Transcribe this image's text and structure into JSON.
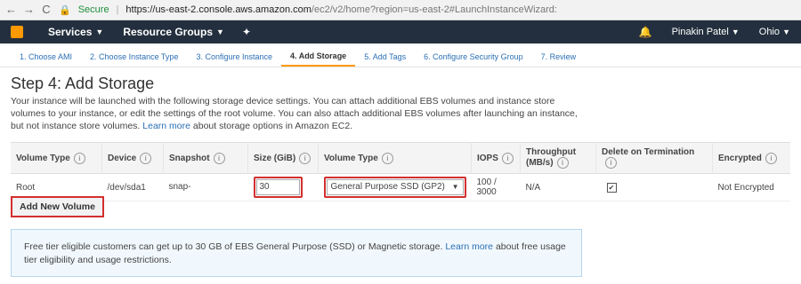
{
  "browser": {
    "secure_label": "Secure",
    "url_host": "https://us-east-2.console.aws.amazon.com",
    "url_path": "/ec2/v2/home?region=us-east-2#LaunchInstanceWizard:"
  },
  "topnav": {
    "services": "Services",
    "resource_groups": "Resource Groups",
    "user": "Pinakin Patel",
    "region": "Ohio"
  },
  "tabs": [
    {
      "label": "1. Choose AMI"
    },
    {
      "label": "2. Choose Instance Type"
    },
    {
      "label": "3. Configure Instance"
    },
    {
      "label": "4. Add Storage"
    },
    {
      "label": "5. Add Tags"
    },
    {
      "label": "6. Configure Security Group"
    },
    {
      "label": "7. Review"
    }
  ],
  "page": {
    "title": "Step 4: Add Storage",
    "description": "Your instance will be launched with the following storage device settings. You can attach additional EBS volumes and instance store volumes to your instance, or edit the settings of the root volume. You can also attach additional EBS volumes after launching an instance, but not instance store volumes.",
    "learn_more": "Learn more",
    "description_tail": "about storage options in Amazon EC2."
  },
  "table": {
    "headers": [
      "Volume Type",
      "Device",
      "Snapshot",
      "Size (GiB)",
      "Volume Type",
      "IOPS",
      "Throughput (MB/s)",
      "Delete on Termination",
      "Encrypted"
    ],
    "row": {
      "volume_type": "Root",
      "device": "/dev/sda1",
      "snapshot": "snap-",
      "size": "30",
      "ebs_type": "General Purpose SSD (GP2)",
      "iops": "100 / 3000",
      "throughput": "N/A",
      "delete_on_termination": "✔",
      "encrypted": "Not Encrypted"
    }
  },
  "add_button": "Add New Volume",
  "note": {
    "text": "Free tier eligible customers can get up to 30 GB of EBS General Purpose (SSD) or Magnetic storage.",
    "learn_more": "Learn more",
    "tail": "about free usage tier eligibility and usage restrictions."
  }
}
